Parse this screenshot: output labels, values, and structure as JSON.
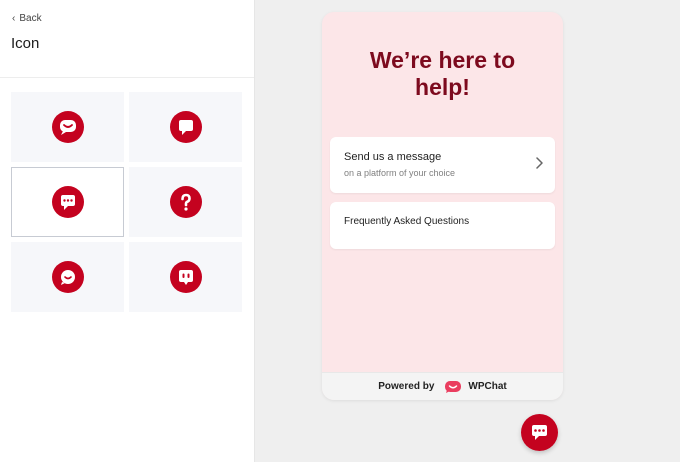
{
  "colors": {
    "accent": "#c4021f",
    "headline": "#7d0a1e",
    "preview_bg": "#fce6e8"
  },
  "left_panel": {
    "back_label": "Back",
    "title": "Icon",
    "icons": [
      {
        "name": "smile-bubble-icon",
        "selected": false
      },
      {
        "name": "square-bubble-icon",
        "selected": false
      },
      {
        "name": "dots-bubble-icon",
        "selected": true
      },
      {
        "name": "question-icon",
        "selected": false
      },
      {
        "name": "smile-circle-icon",
        "selected": false
      },
      {
        "name": "eyes-square-icon",
        "selected": false
      }
    ]
  },
  "preview": {
    "headline": "We’re here to\nhelp!",
    "message_option": {
      "title": "Send us a message",
      "subtitle": "on a platform of your choice"
    },
    "faq_option": {
      "title": "Frequently Asked Questions"
    },
    "footer": {
      "powered_by": "Powered by",
      "brand": "WPChat"
    }
  },
  "launcher": {
    "icon": "dots-bubble-icon"
  }
}
